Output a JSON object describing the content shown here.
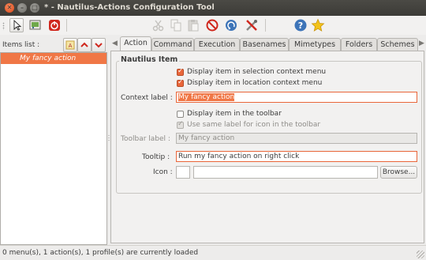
{
  "window": {
    "title": "* - Nautilus-Actions Configuration Tool"
  },
  "toolbar": {
    "icons": [
      "pointer-icon",
      "new-item-icon",
      "quit-icon",
      "cut-icon",
      "copy-icon",
      "paste-icon",
      "delete-icon",
      "undo-icon",
      "tools-icon",
      "help-icon",
      "star-icon"
    ]
  },
  "sidebar": {
    "items_label": "Items list :",
    "items": [
      {
        "label": "My fancy action"
      }
    ]
  },
  "tabs": [
    {
      "label": "Action",
      "active": true
    },
    {
      "label": "Command"
    },
    {
      "label": "Execution"
    },
    {
      "label": "Basenames"
    },
    {
      "label": "Mimetypes"
    },
    {
      "label": "Folders"
    },
    {
      "label": "Schemes"
    }
  ],
  "form": {
    "section_title": "Nautilus Item",
    "cb_selection": {
      "label": "Display item in selection context menu",
      "checked": true
    },
    "cb_location": {
      "label": "Display item in location context menu",
      "checked": true
    },
    "context_label": {
      "label": "Context label :",
      "value": "My fancy action"
    },
    "cb_toolbar": {
      "label": "Display item in the toolbar",
      "checked": false
    },
    "cb_same_label": {
      "label": "Use same label for icon in the toolbar",
      "checked": true,
      "disabled": true
    },
    "toolbar_label": {
      "label": "Toolbar label :",
      "value": "My fancy action"
    },
    "tooltip": {
      "label": "Tooltip :",
      "value": "Run my fancy action on right click"
    },
    "icon": {
      "label": "Icon :",
      "value": "",
      "browse_label": "Browse..."
    }
  },
  "status": {
    "text": "0 menu(s), 1 action(s), 1 profile(s) are currently loaded"
  },
  "colors": {
    "accent": "#f07746",
    "titlebar": "#3c3b37"
  }
}
